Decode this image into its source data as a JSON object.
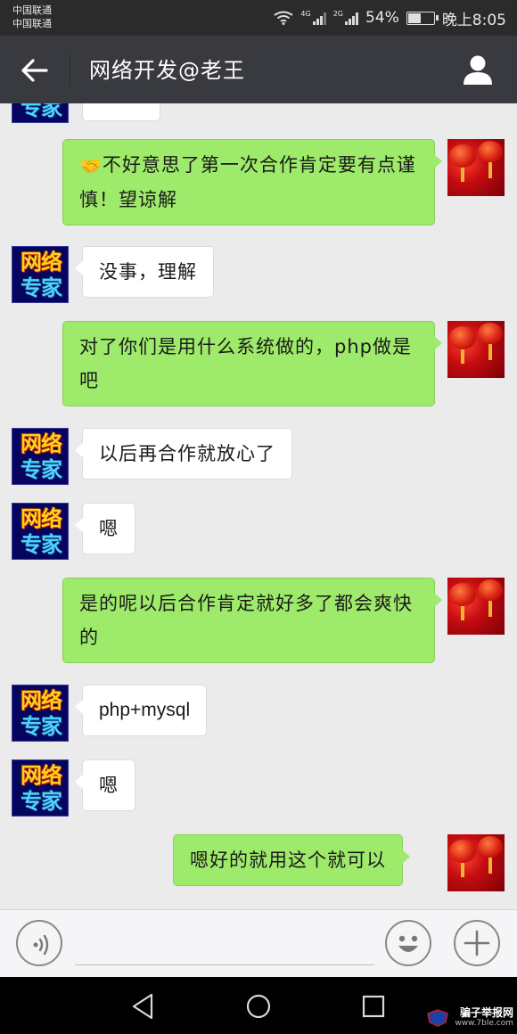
{
  "status_bar": {
    "carrier_1": "中国联通",
    "carrier_2": "中国联通",
    "net_4g": "4G",
    "net_2g": "2G",
    "battery": "54%",
    "battery_level": 0.54,
    "time": "晚上8:05"
  },
  "header": {
    "title": "网络开发@老王"
  },
  "avatars": {
    "contact_line1": "网络",
    "contact_line2": "专家"
  },
  "messages": [
    {
      "side": "out",
      "icon": "handshake-icon",
      "text": "不好意思了第一次合作肯定要有点谨慎！望谅解"
    },
    {
      "side": "in",
      "text": "没事，理解"
    },
    {
      "side": "out",
      "text": "对了你们是用什么系统做的，php做是吧"
    },
    {
      "side": "in",
      "text": "以后再合作就放心了"
    },
    {
      "side": "in",
      "text": "嗯"
    },
    {
      "side": "out",
      "text": "是的呢以后合作肯定就好多了都会爽快的"
    },
    {
      "side": "in",
      "text": "php+mysql"
    },
    {
      "side": "in",
      "text": "嗯"
    },
    {
      "side": "out",
      "text": "嗯好的就用这个就可以"
    }
  ],
  "watermark": {
    "main": "骗子举报网",
    "sub": "www.7ble.com"
  },
  "colors": {
    "status_bar": "#2b2b2b",
    "title_bar": "#393a3f",
    "chat_bg": "#ebebeb",
    "bubble_out": "#9eea6a",
    "bubble_in": "#ffffff"
  }
}
